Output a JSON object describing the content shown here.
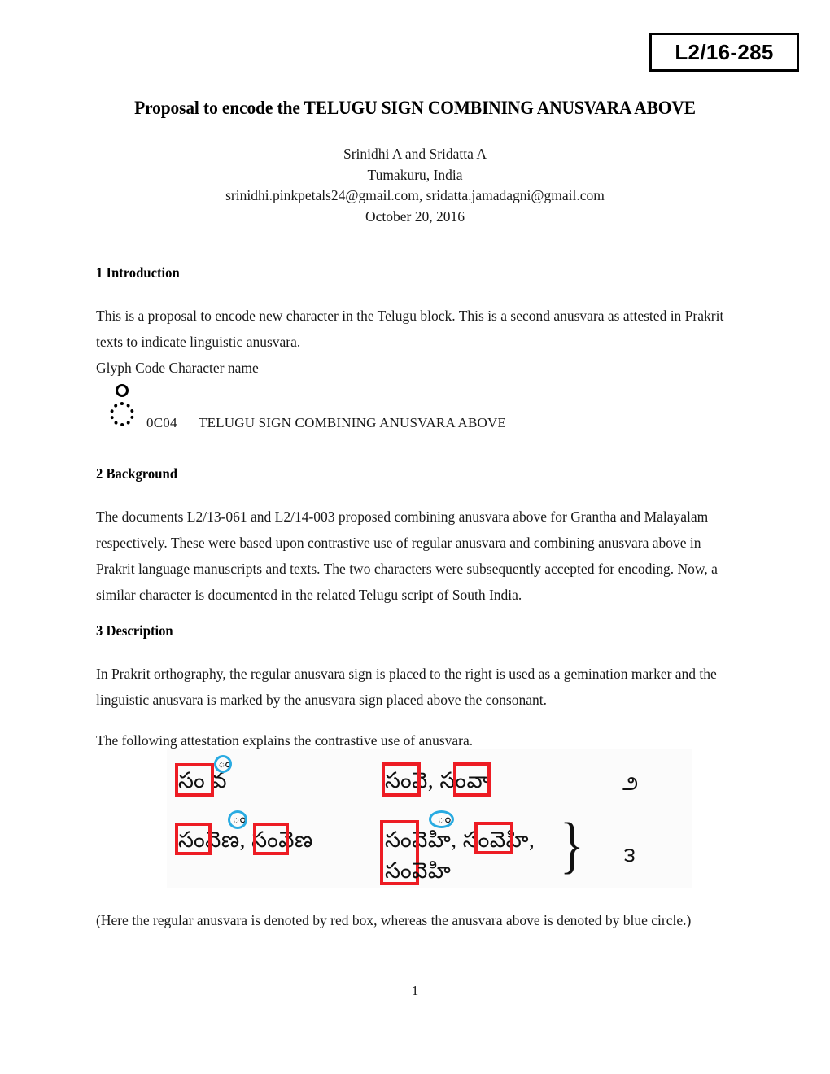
{
  "document": {
    "number_box": "L2/16-285",
    "title": "Proposal to encode the TELUGU SIGN COMBINING ANUSVARA ABOVE",
    "page_number": "1"
  },
  "authors": {
    "names": "Srinidhi A and Sridatta A",
    "affiliation": "Tumakuru, India",
    "emails": "srinidhi.pinkpetals24@gmail.com, sridatta.jamadagni@gmail.com",
    "date": "October 20, 2016"
  },
  "sections": {
    "introduction": {
      "heading": "1 Introduction",
      "paragraph": "This is a proposal to encode new character in the Telugu block. This is a second anusvara as attested in Prakrit texts to indicate linguistic anusvara.",
      "table_header": "Glyph     Code     Character name",
      "entry": {
        "glyph_icon": "anusvara-above-dotted-circle-glyph",
        "code": "0C04",
        "character_name": "TELUGU SIGN COMBINING ANUSVARA ABOVE"
      }
    },
    "background": {
      "heading": "2 Background",
      "paragraph": "The documents L2/13-061 and L2/14-003 proposed combining anusvara above for Grantha and Malayalam respectively. These were based upon contrastive use of regular anusvara and combining anusvara above in Prakrit language manuscripts and texts. The two characters were subsequently accepted for encoding. Now, a similar character is documented in the related Telugu script of South India."
    },
    "description": {
      "heading": "3 Description",
      "paragraph1": "In Prakrit orthography, the regular anusvara sign is placed to the right is used as a gemination marker and the linguistic anusvara is marked by the anusvara sign placed above the consonant.",
      "paragraph2": "The following attestation explains the contrastive use of anusvara."
    }
  },
  "figure": {
    "caption": "(Here the regular anusvara is denoted by red box, whereas the anusvara above is denoted by blue circle.)",
    "annotation_colors": {
      "red_box": "#ED1C24",
      "blue_circle": "#29ABE2"
    },
    "lines": [
      {
        "id": "left-row-1",
        "text": "సం వ"
      },
      {
        "id": "left-row-2",
        "text": "సంవెణ, సంవెణ"
      },
      {
        "id": "right-row-1",
        "text": "సంవె, సంవా"
      },
      {
        "id": "right-row-2",
        "text": "సంవెహి, సంవెహి,"
      },
      {
        "id": "right-row-3",
        "text": "సంవెహి"
      }
    ],
    "anusvara_above_marks": [
      "ం",
      "ం",
      "ం"
    ],
    "telugu_digits": [
      "౨",
      "౩"
    ],
    "brace": "}"
  }
}
